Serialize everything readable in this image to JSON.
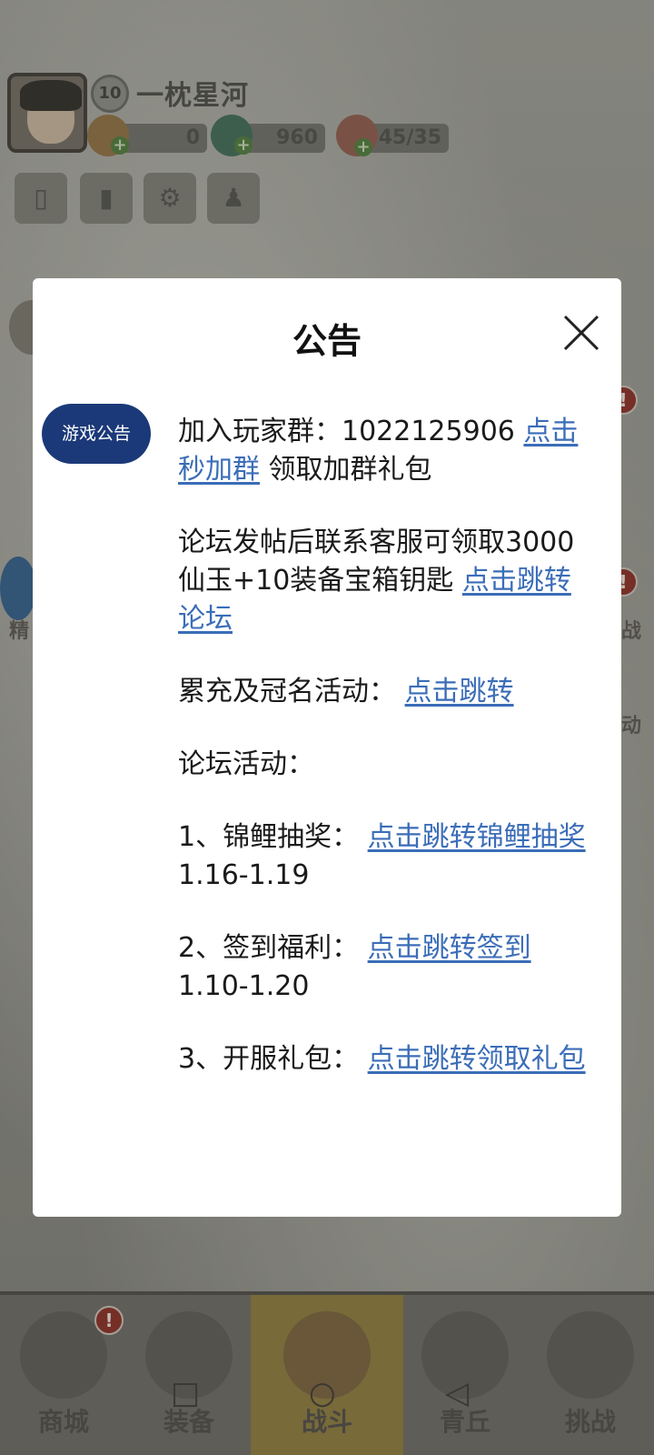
{
  "player": {
    "level": "10",
    "name": "一枕星河",
    "resources": [
      {
        "icon": "gold-icon",
        "value": "0"
      },
      {
        "icon": "dragon-jade-icon",
        "value": "960"
      },
      {
        "icon": "peach-stamina-icon",
        "value": "45/35"
      }
    ]
  },
  "side": {
    "left_label": "精",
    "right_labels": [
      "战",
      "动"
    ],
    "alert_glyph": "!"
  },
  "modal": {
    "title": "公告",
    "tab_label": "游戏公告",
    "items": [
      {
        "text": "加入玩家群：1022125906 ",
        "link": "点击秒加群",
        "suffix": " 领取加群礼包"
      },
      {
        "text": "论坛发帖后联系客服可领取3000仙玉+10装备宝箱钥匙 ",
        "link": "点击跳转论坛",
        "suffix": ""
      },
      {
        "text": "累充及冠名活动：  ",
        "link": "点击跳转",
        "suffix": ""
      },
      {
        "text": "论坛活动：",
        "link": "",
        "suffix": ""
      },
      {
        "text": "1、锦鲤抽奖：  ",
        "link": "点击跳转锦鲤抽奖",
        "suffix": " 1.16-1.19"
      },
      {
        "text": "2、签到福利：  ",
        "link": "点击跳转签到",
        "suffix": " 1.10-1.20"
      },
      {
        "text": "3、开服礼包：  ",
        "link": "点击跳转领取礼包",
        "suffix": ""
      }
    ]
  },
  "nav": {
    "items": [
      {
        "label": "商城",
        "icon": "shop-icon"
      },
      {
        "label": "装备",
        "icon": "armor-icon"
      },
      {
        "label": "战斗",
        "icon": "crossed-swords-icon"
      },
      {
        "label": "青丘",
        "icon": "mountain-icon"
      },
      {
        "label": "挑战",
        "icon": "portal-icon"
      }
    ]
  },
  "system": {
    "recents_glyph": "□",
    "home_glyph": "○",
    "back_glyph": "◁"
  }
}
